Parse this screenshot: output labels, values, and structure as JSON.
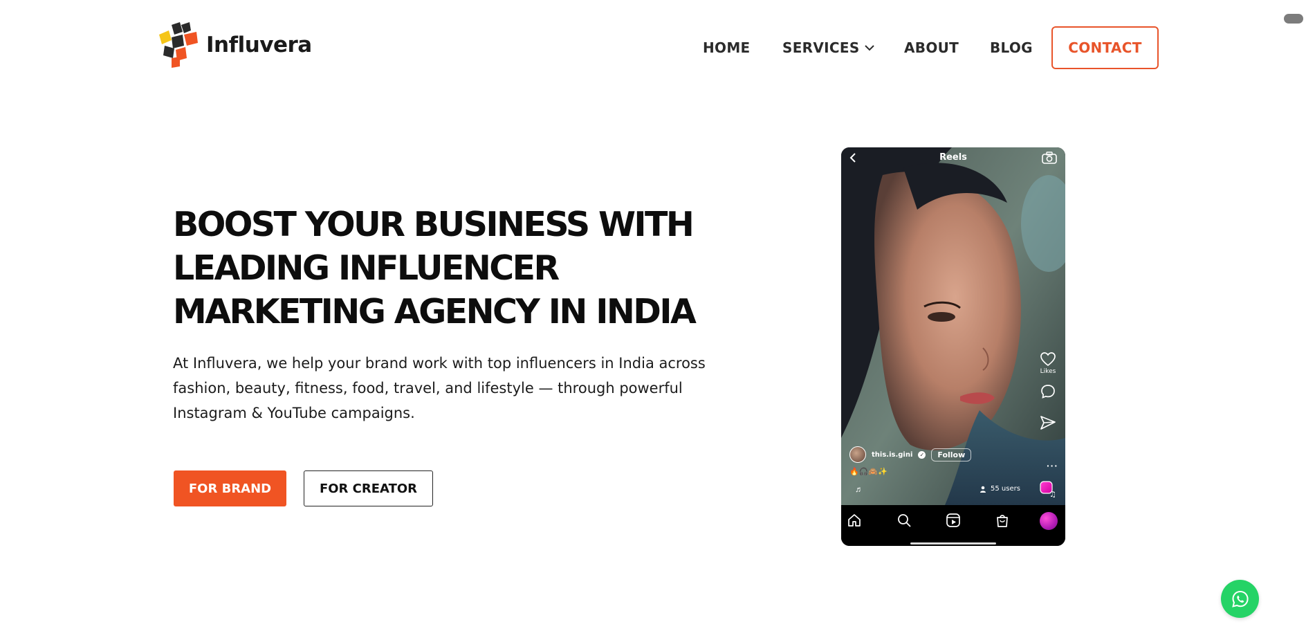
{
  "brand": {
    "name": "Influvera",
    "accent_color": "#f05423",
    "logo_icon": "influvera-logo-icon"
  },
  "nav": {
    "items": [
      {
        "label": "HOME"
      },
      {
        "label": "SERVICES",
        "icon": "chevron-down-icon"
      },
      {
        "label": "ABOUT"
      },
      {
        "label": "BLOG"
      }
    ],
    "contact_label": "CONTACT"
  },
  "hero": {
    "title_lines": [
      "BOOST YOUR BUSINESS WITH",
      "LEADING INFLUENCER",
      "MARKETING AGENCY IN INDIA"
    ],
    "description": "At Influvera, we help your brand work with top influencers in India across fashion, beauty, fitness, food, travel, and lifestyle — through powerful Instagram & YouTube campaigns.",
    "cta_brand": "FOR BRAND",
    "cta_creator": "FOR CREATOR"
  },
  "phone": {
    "screen_title": "Reels",
    "likes_label": "Likes",
    "username": "this.is.gini",
    "follow_label": "Follow",
    "caption_emojis": "🔥🎧🙈✨",
    "users_count": "55 users",
    "icons": [
      "back-arrow-icon",
      "camera-icon",
      "heart-icon",
      "comment-icon",
      "send-icon",
      "more-icon",
      "remix-icon",
      "home-icon",
      "search-icon",
      "reels-icon",
      "shop-icon",
      "profile-icon"
    ]
  },
  "floating": {
    "whatsapp_icon": "whatsapp-icon",
    "whatsapp_color": "#25d366"
  }
}
